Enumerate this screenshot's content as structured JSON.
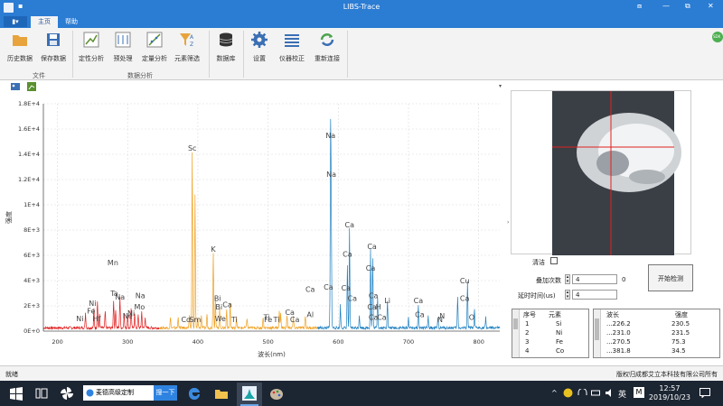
{
  "window": {
    "title": "LIBS-Trace",
    "dot": "▪",
    "min": "—",
    "restore": "⧉",
    "close": "✕",
    "pin": "⧈"
  },
  "tabs": {
    "file": "▮▾",
    "items": [
      "主页",
      "帮助"
    ]
  },
  "ribbon": {
    "buttons": [
      {
        "label": "历史数据",
        "icon": "folder-icon",
        "color": "#e8a33c"
      },
      {
        "label": "保存数据",
        "icon": "save-icon",
        "color": "#3a6fb4"
      },
      {
        "label": "定性分析",
        "icon": "qualitative-icon",
        "color": "#5a8f2e"
      },
      {
        "label": "预处理",
        "icon": "preprocess-icon",
        "color": "#3a6fb4"
      },
      {
        "label": "定量分析",
        "icon": "quantitative-icon",
        "color": "#5a8f2e"
      },
      {
        "label": "元素筛选",
        "icon": "filter-az-icon",
        "color": "#e8a33c"
      },
      {
        "label": "数据库",
        "icon": "database-icon",
        "color": "#333333"
      },
      {
        "label": "设置",
        "icon": "gear-icon",
        "color": "#3a6fb4"
      },
      {
        "label": "仪器校正",
        "icon": "calibration-icon",
        "color": "#3a6fb4"
      },
      {
        "label": "重新连接",
        "icon": "reconnect-icon",
        "color": "#4ca34c"
      }
    ],
    "groups": [
      "文件",
      "数据分析"
    ],
    "badge": "SDK"
  },
  "chart_data": {
    "type": "line",
    "xlabel": "波长(nm)",
    "ylabel": "强度",
    "xlim": [
      180,
      830
    ],
    "ylim": [
      0,
      18000
    ],
    "x_ticks": [
      200,
      300,
      400,
      500,
      600,
      700,
      800
    ],
    "y_ticks": [
      {
        "v": 0,
        "label": "0E+0"
      },
      {
        "v": 2000,
        "label": "2E+3"
      },
      {
        "v": 4000,
        "label": "4E+3"
      },
      {
        "v": 6000,
        "label": "6E+3"
      },
      {
        "v": 8000,
        "label": "8E+3"
      },
      {
        "v": 10000,
        "label": "1E+4"
      },
      {
        "v": 12000,
        "label": "1.2E+4"
      },
      {
        "v": 14000,
        "label": "1.4E+4"
      },
      {
        "v": 16000,
        "label": "1.6E+4"
      },
      {
        "v": 18000,
        "label": "1.8E+4"
      }
    ],
    "series": [
      {
        "color": "#e02020",
        "range": [
          180,
          345
        ],
        "peaks": [
          [
            240,
            1200
          ],
          [
            252,
            1500
          ],
          [
            257,
            2200
          ],
          [
            260,
            1100
          ],
          [
            268,
            1300
          ],
          [
            280,
            2200
          ],
          [
            283,
            1500
          ],
          [
            289,
            2500
          ],
          [
            295,
            1200
          ],
          [
            300,
            1100
          ],
          [
            305,
            1600
          ],
          [
            310,
            1200
          ],
          [
            315,
            1000
          ],
          [
            320,
            1300
          ],
          [
            325,
            900
          ]
        ]
      },
      {
        "color": "#f0a020",
        "range": [
          345,
          570
        ],
        "peaks": [
          [
            361,
            800
          ],
          [
            372,
            900
          ],
          [
            388,
            900
          ],
          [
            392,
            14000
          ],
          [
            396,
            10500
          ],
          [
            400,
            800
          ],
          [
            405,
            1000
          ],
          [
            413,
            1100
          ],
          [
            422,
            6000
          ],
          [
            425,
            2500
          ],
          [
            431,
            1500
          ],
          [
            441,
            1500
          ],
          [
            446,
            2000
          ],
          [
            455,
            900
          ],
          [
            470,
            800
          ],
          [
            493,
            900
          ],
          [
            516,
            1400
          ],
          [
            518,
            1100
          ],
          [
            527,
            1000
          ],
          [
            536,
            900
          ],
          [
            553,
            1000
          ]
        ]
      },
      {
        "color": "#2080c0",
        "range": [
          570,
          830
        ],
        "peaks": [
          [
            589,
            15200
          ],
          [
            590,
            9500
          ],
          [
            603,
            1800
          ],
          [
            613,
            5000
          ],
          [
            616,
            7800
          ],
          [
            630,
            1000
          ],
          [
            646,
            6300
          ],
          [
            649,
            5500
          ],
          [
            656,
            2500
          ],
          [
            670,
            2200
          ],
          [
            700,
            800
          ],
          [
            714,
            1800
          ],
          [
            728,
            900
          ],
          [
            742,
            800
          ],
          [
            770,
            2400
          ],
          [
            784,
            3600
          ],
          [
            794,
            1400
          ],
          [
            810,
            800
          ]
        ]
      }
    ],
    "labels": [
      {
        "t": "Sc",
        "x": 392,
        "y": 14300
      },
      {
        "t": "K",
        "x": 422,
        "y": 6300
      },
      {
        "t": "Na",
        "x": 589,
        "y": 15300
      },
      {
        "t": "Na",
        "x": 590,
        "y": 12200
      },
      {
        "t": "Ca",
        "x": 616,
        "y": 8200
      },
      {
        "t": "Ca",
        "x": 613,
        "y": 5900
      },
      {
        "t": "Ca",
        "x": 648,
        "y": 6500
      },
      {
        "t": "Ca",
        "x": 646,
        "y": 4800
      },
      {
        "t": "Ca",
        "x": 560,
        "y": 3100
      },
      {
        "t": "Ca",
        "x": 586,
        "y": 3300
      },
      {
        "t": "Ca",
        "x": 611,
        "y": 3200
      },
      {
        "t": "Ca",
        "x": 620,
        "y": 2400
      },
      {
        "t": "Ca",
        "x": 650,
        "y": 2600
      },
      {
        "t": "Ca",
        "x": 648,
        "y": 1700
      },
      {
        "t": "H",
        "x": 657,
        "y": 1700
      },
      {
        "t": "Ca",
        "x": 650,
        "y": 900
      },
      {
        "t": "Ca",
        "x": 662,
        "y": 900
      },
      {
        "t": "Li",
        "x": 670,
        "y": 2200
      },
      {
        "t": "Ca",
        "x": 714,
        "y": 2200
      },
      {
        "t": "Ca",
        "x": 716,
        "y": 1100
      },
      {
        "t": "N",
        "x": 745,
        "y": 700
      },
      {
        "t": "N",
        "x": 748,
        "y": 1000
      },
      {
        "t": "Cu",
        "x": 780,
        "y": 3800
      },
      {
        "t": "Ca",
        "x": 780,
        "y": 2400
      },
      {
        "t": "O",
        "x": 790,
        "y": 900
      },
      {
        "t": "Al",
        "x": 560,
        "y": 1100
      },
      {
        "t": "Mn",
        "x": 279,
        "y": 5200
      },
      {
        "t": "Ta",
        "x": 281,
        "y": 2800
      },
      {
        "t": "Na",
        "x": 289,
        "y": 2500
      },
      {
        "t": "Na",
        "x": 318,
        "y": 2600
      },
      {
        "t": "Mo",
        "x": 317,
        "y": 1700
      },
      {
        "t": "Ni",
        "x": 305,
        "y": 1200
      },
      {
        "t": "Ne",
        "x": 300,
        "y": 1000
      },
      {
        "t": "Ni",
        "x": 250,
        "y": 2000
      },
      {
        "t": "Bi",
        "x": 428,
        "y": 2400
      },
      {
        "t": "Ca",
        "x": 442,
        "y": 1900
      },
      {
        "t": "Bi",
        "x": 430,
        "y": 1700
      },
      {
        "t": "We",
        "x": 432,
        "y": 800
      },
      {
        "t": "Ti",
        "x": 452,
        "y": 700
      },
      {
        "t": "Ti",
        "x": 498,
        "y": 900
      },
      {
        "t": "Fe",
        "x": 500,
        "y": 700
      },
      {
        "t": "Ti",
        "x": 512,
        "y": 700
      },
      {
        "t": "Ca",
        "x": 531,
        "y": 1300
      },
      {
        "t": "Ca",
        "x": 538,
        "y": 700
      },
      {
        "t": "Co",
        "x": 383,
        "y": 700
      },
      {
        "t": "Sm",
        "x": 396,
        "y": 700
      },
      {
        "t": "Ni",
        "x": 232,
        "y": 800
      },
      {
        "t": "Fe",
        "x": 248,
        "y": 1400
      },
      {
        "t": "Hf",
        "x": 256,
        "y": 800
      }
    ]
  },
  "right": {
    "clear_label": "清洁",
    "avg_label": "叠加次数",
    "avg_value": "4",
    "avg_count": "0",
    "delay_label": "延时时间(us)",
    "delay_value": "4",
    "start_button": "开始检测",
    "elements": {
      "headers": [
        "序号",
        "元素"
      ],
      "rows": [
        [
          "1",
          "Si"
        ],
        [
          "2",
          "Ni"
        ],
        [
          "3",
          "Fe"
        ],
        [
          "4",
          "Co"
        ]
      ]
    },
    "wave": {
      "headers": [
        "波长",
        "强度"
      ],
      "rows": [
        [
          "...226.2",
          "230.5"
        ],
        [
          "...231.0",
          "231.5"
        ],
        [
          "...270.5",
          "75.3"
        ],
        [
          "...381.8",
          "34.5"
        ]
      ]
    }
  },
  "status": {
    "left": "就绪",
    "right": "版权归成都艾立本科技有限公司所有"
  },
  "taskbar": {
    "search_text": "麦德高级定制",
    "search_button": "搜一下",
    "ime": "英",
    "ime2": "M",
    "time": "12:57",
    "date": "2019/10/23"
  }
}
